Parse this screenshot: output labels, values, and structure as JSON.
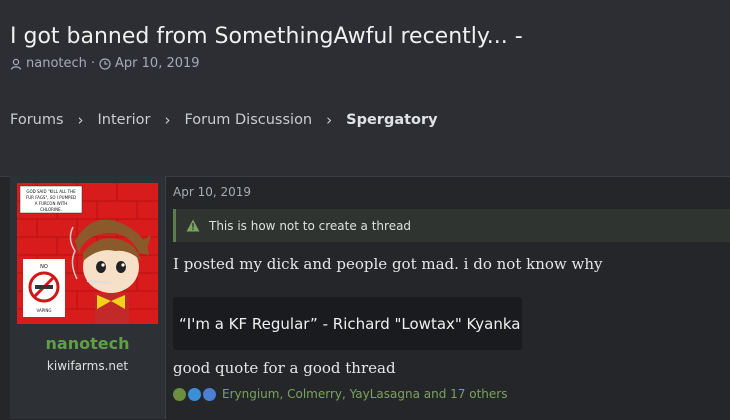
{
  "thread": {
    "title": "I got banned from SomethingAwful recently... -",
    "author": "nanotech",
    "date": "Apr 10, 2019"
  },
  "breadcrumb": [
    "Forums",
    "Interior",
    "Forum Discussion",
    "Spergatory"
  ],
  "post": {
    "date": "Apr 10, 2019",
    "warning": "This is how not to create a thread",
    "line1": "I posted my dick and people got mad. i do not know why",
    "quote": "“I'm a KF Regular” - Richard \"Lowtax\" Kyanka",
    "line2": "good quote for a good thread",
    "reactions": "Eryngium, Colmerry, YayLasagna and 17 others"
  },
  "user": {
    "name": "nanotech",
    "title": "kiwifarms.net",
    "avatar_caption": "GOD SAID \"KILL ALL THE FUR FAGS\", SO I PUMPED A FURCON WITH CHLORINE.",
    "sign_no": "NO",
    "sign_vaping": "VAPING"
  },
  "colors": {
    "accent_green": "#5fa047",
    "reaction_text": "#7aa35c",
    "background": "#2c2e33"
  },
  "icons": {
    "author": "user-icon",
    "date": "clock-icon",
    "warning": "warning-triangle-icon",
    "separator": "chevron-right-icon"
  }
}
